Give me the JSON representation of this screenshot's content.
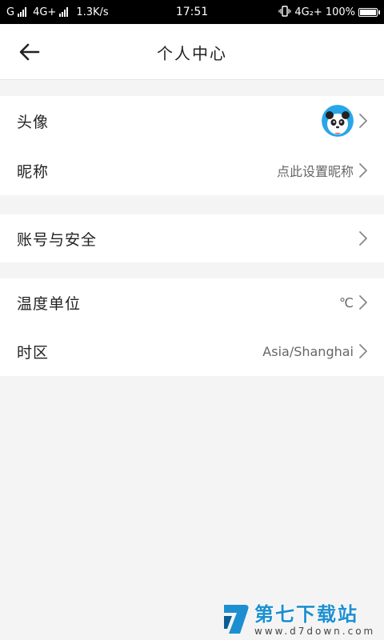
{
  "status_bar": {
    "carrier_left": "G",
    "network_left": "4G+",
    "speed": "1.3K/s",
    "time": "17:51",
    "network_right": "4G₂+",
    "battery": "100%",
    "battery_level": 1.0
  },
  "header": {
    "title": "个人中心"
  },
  "sections": [
    {
      "rows": [
        {
          "label": "头像",
          "value": ""
        },
        {
          "label": "昵称",
          "value": "点此设置昵称"
        }
      ]
    },
    {
      "rows": [
        {
          "label": "账号与安全",
          "value": ""
        }
      ]
    },
    {
      "rows": [
        {
          "label": "温度单位",
          "value": "℃"
        },
        {
          "label": "时区",
          "value": "Asia/Shanghai"
        }
      ]
    }
  ],
  "watermark": {
    "title": "第七下载站",
    "url": "www.d7down.com"
  },
  "colors": {
    "background": "#f4f4f4",
    "watermark_blue": "#1d8fd0",
    "avatar_blue": "#29a6e8"
  }
}
